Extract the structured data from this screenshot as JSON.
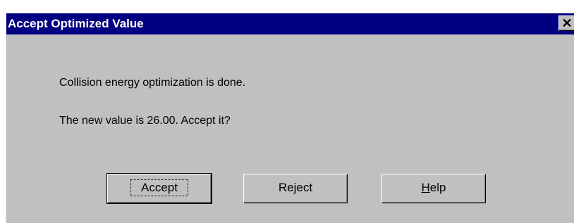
{
  "window": {
    "title": "Accept Optimized Value",
    "close_glyph": "✕"
  },
  "message": {
    "line1": "Collision energy optimization is done.",
    "line2": "The new value is 26.00.  Accept it?"
  },
  "buttons": {
    "accept_label": "Accept",
    "reject_label": "Reject",
    "help_first_letter": "H",
    "help_rest": "elp"
  },
  "colors": {
    "titlebar": "#000080",
    "dialog_face": "#c0c0c0"
  }
}
